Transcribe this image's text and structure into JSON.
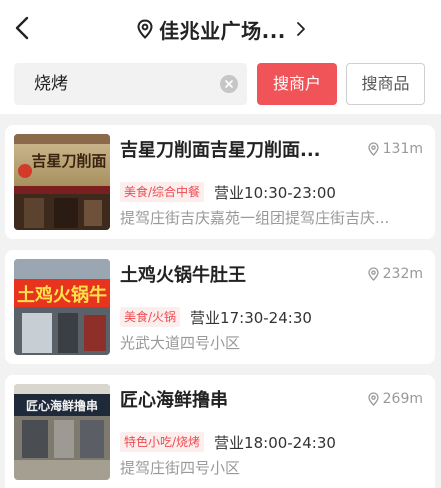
{
  "header": {
    "title": "佳兆业广场..."
  },
  "search": {
    "value": "烧烤",
    "merchant_button": "搜商户",
    "goods_button": "搜商品"
  },
  "shops": [
    {
      "name": "吉星刀削面吉星刀削面...",
      "distance": "131m",
      "tag": "美食/综合中餐",
      "hours": "营业10:30-23:00",
      "address": "提驾庄街吉庆嘉苑一组团提驾庄街吉庆...",
      "sign": "吉星刀削面"
    },
    {
      "name": "土鸡火锅牛肚王",
      "distance": "232m",
      "tag": "美食/火锅",
      "hours": "营业17:30-24:30",
      "address": "光武大道四号小区",
      "sign": "土鸡火锅牛"
    },
    {
      "name": "匠心海鲜撸串",
      "distance": "269m",
      "tag": "特色小吃/烧烤",
      "hours": "营业18:00-24:30",
      "address": "提驾庄街四号小区",
      "sign": "匠心海鲜撸串"
    }
  ],
  "colors": {
    "accent": "#f05459",
    "tag_text": "#ec4c51",
    "tag_bg": "#fdeeee",
    "muted": "#999999"
  }
}
